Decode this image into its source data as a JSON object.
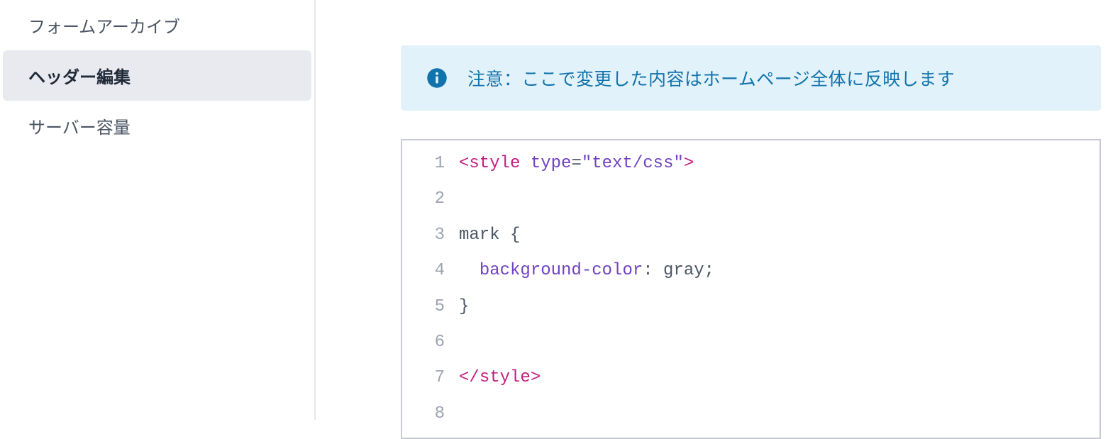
{
  "sidebar": {
    "items": [
      {
        "label": "フォームアーカイブ",
        "active": false
      },
      {
        "label": "ヘッダー編集",
        "active": true
      },
      {
        "label": "サーバー容量",
        "active": false
      }
    ]
  },
  "alert": {
    "text": "注意：ここで変更した内容はホームページ全体に反映します"
  },
  "code": {
    "lines": [
      {
        "num": "1",
        "tokens": [
          {
            "t": "<",
            "c": "tok-bracket"
          },
          {
            "t": "style",
            "c": "tok-tag"
          },
          {
            "t": " ",
            "c": "tok-plain"
          },
          {
            "t": "type",
            "c": "tok-attr"
          },
          {
            "t": "=",
            "c": "tok-eq"
          },
          {
            "t": "\"text/css\"",
            "c": "tok-string"
          },
          {
            "t": ">",
            "c": "tok-bracket"
          }
        ]
      },
      {
        "num": "2",
        "tokens": []
      },
      {
        "num": "3",
        "tokens": [
          {
            "t": "mark {",
            "c": "tok-selector"
          }
        ]
      },
      {
        "num": "4",
        "tokens": [
          {
            "t": "  ",
            "c": "tok-plain"
          },
          {
            "t": "background-color",
            "c": "tok-prop"
          },
          {
            "t": ": gray;",
            "c": "tok-value"
          }
        ]
      },
      {
        "num": "5",
        "tokens": [
          {
            "t": "}",
            "c": "tok-selector"
          }
        ]
      },
      {
        "num": "6",
        "tokens": []
      },
      {
        "num": "7",
        "tokens": [
          {
            "t": "</",
            "c": "tok-bracket"
          },
          {
            "t": "style",
            "c": "tok-tag"
          },
          {
            "t": ">",
            "c": "tok-bracket"
          }
        ]
      },
      {
        "num": "8",
        "tokens": []
      }
    ]
  }
}
